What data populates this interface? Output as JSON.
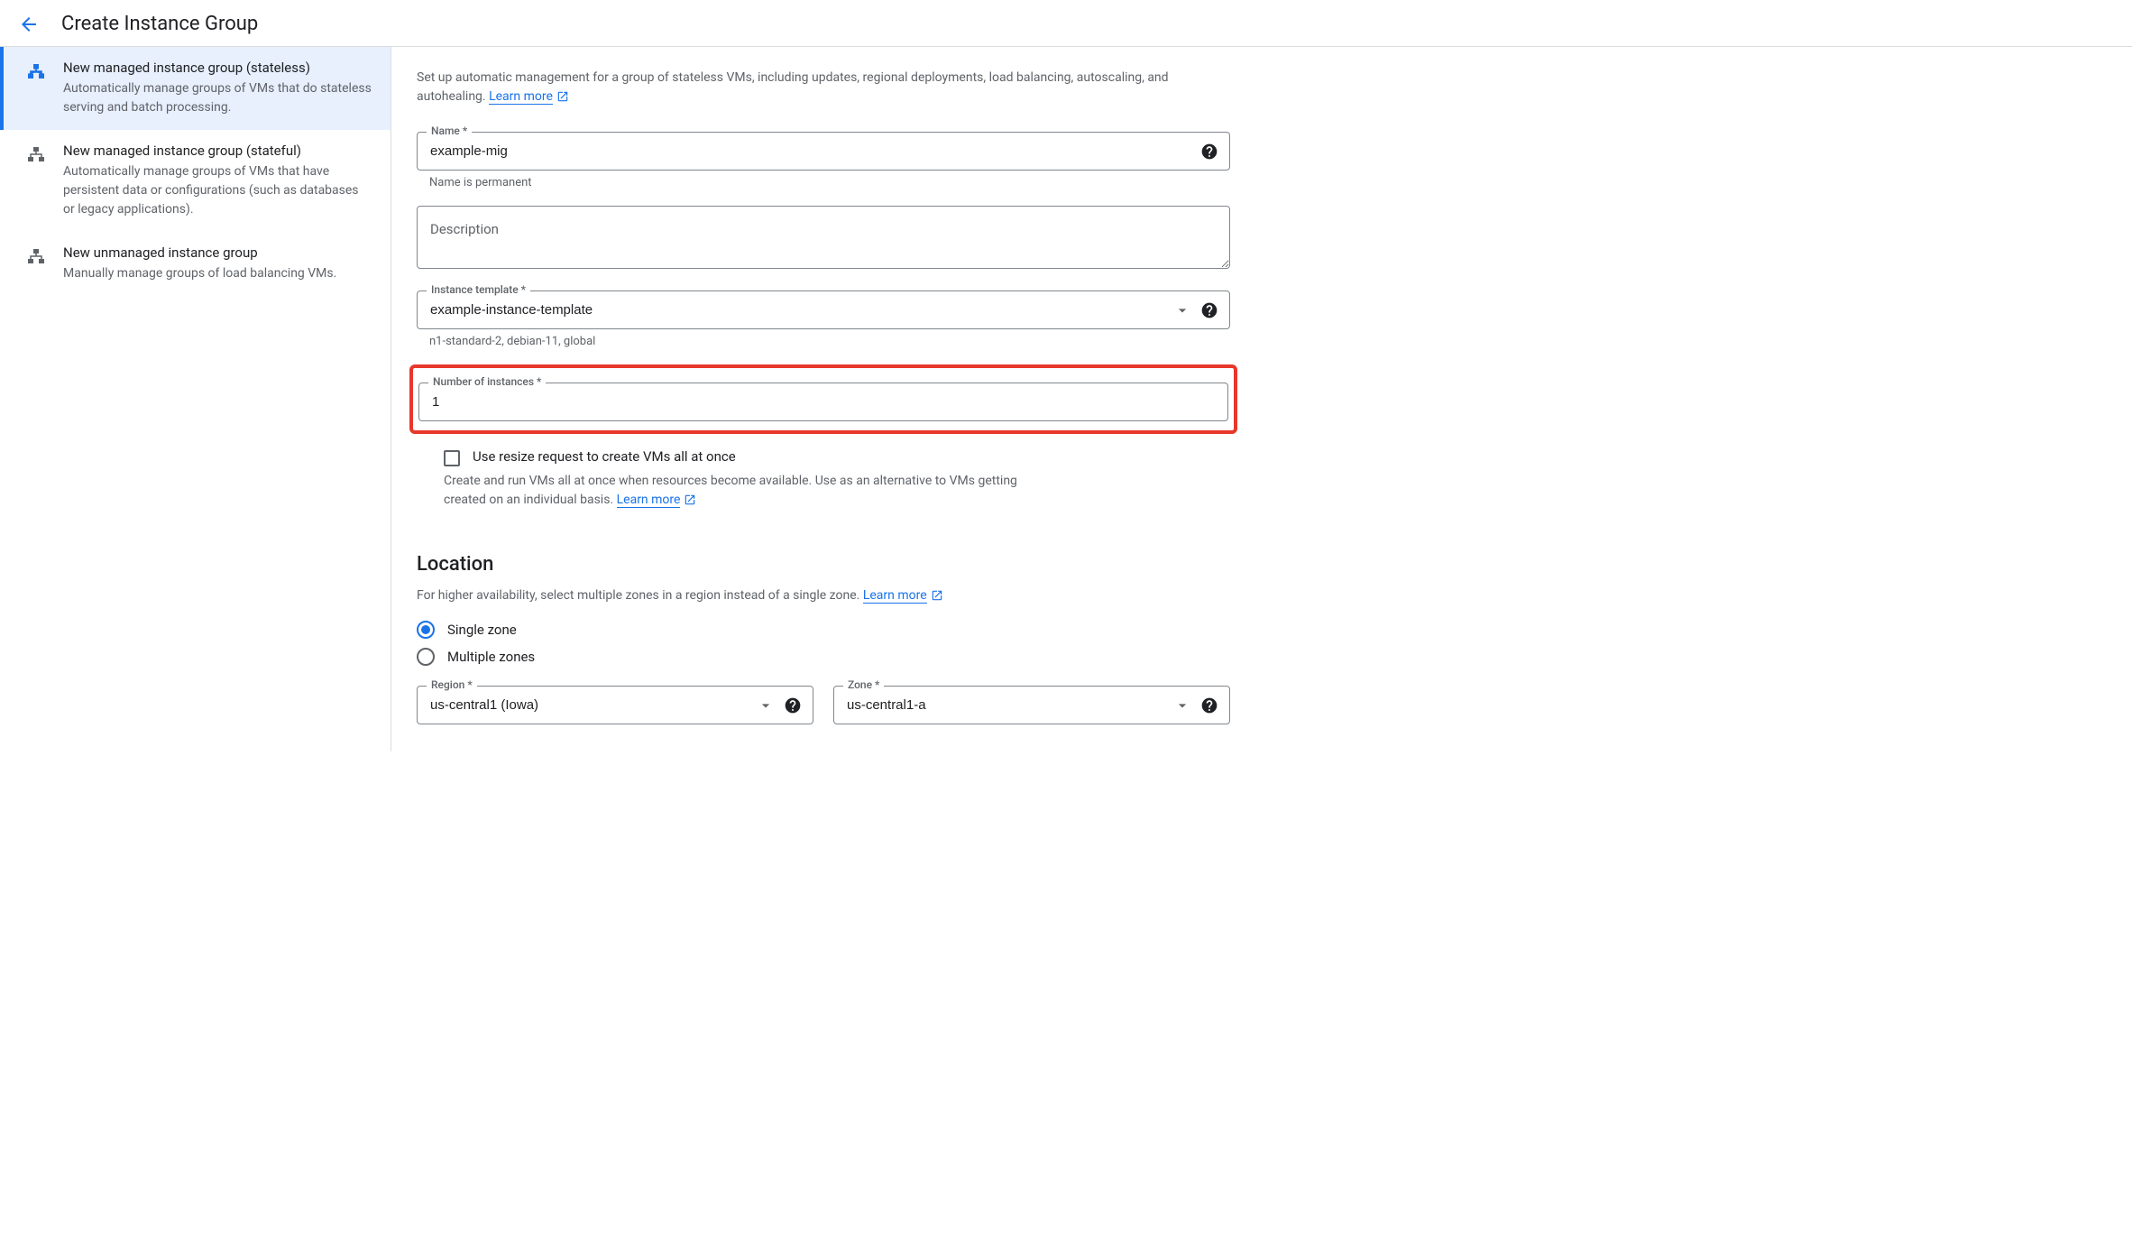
{
  "header": {
    "title": "Create Instance Group"
  },
  "sidebar": {
    "items": [
      {
        "title": "New managed instance group (stateless)",
        "desc": "Automatically manage groups of VMs that do stateless serving and batch processing."
      },
      {
        "title": "New managed instance group (stateful)",
        "desc": "Automatically manage groups of VMs that have persistent data or configurations (such as databases or legacy applications)."
      },
      {
        "title": "New unmanaged instance group",
        "desc": "Manually manage groups of load balancing VMs."
      }
    ]
  },
  "main": {
    "intro": "Set up automatic management for a group of stateless VMs, including updates, regional deployments, load balancing, autoscaling, and autohealing.",
    "learn_more": "Learn more",
    "name": {
      "label": "Name *",
      "value": "example-mig",
      "helper": "Name is permanent"
    },
    "description": {
      "placeholder": "Description"
    },
    "template": {
      "label": "Instance template *",
      "value": "example-instance-template",
      "helper": "n1-standard-2, debian-11, global"
    },
    "instances": {
      "label": "Number of instances *",
      "value": "1"
    },
    "resize": {
      "label": "Use resize request to create VMs all at once",
      "desc": "Create and run VMs all at once when resources become available. Use as an alternative to VMs getting created on an individual basis."
    },
    "location": {
      "title": "Location",
      "desc": "For higher availability, select multiple zones in a region instead of a single zone.",
      "single": "Single zone",
      "multiple": "Multiple zones",
      "region": {
        "label": "Region *",
        "value": "us-central1 (Iowa)"
      },
      "zone": {
        "label": "Zone *",
        "value": "us-central1-a"
      }
    }
  }
}
